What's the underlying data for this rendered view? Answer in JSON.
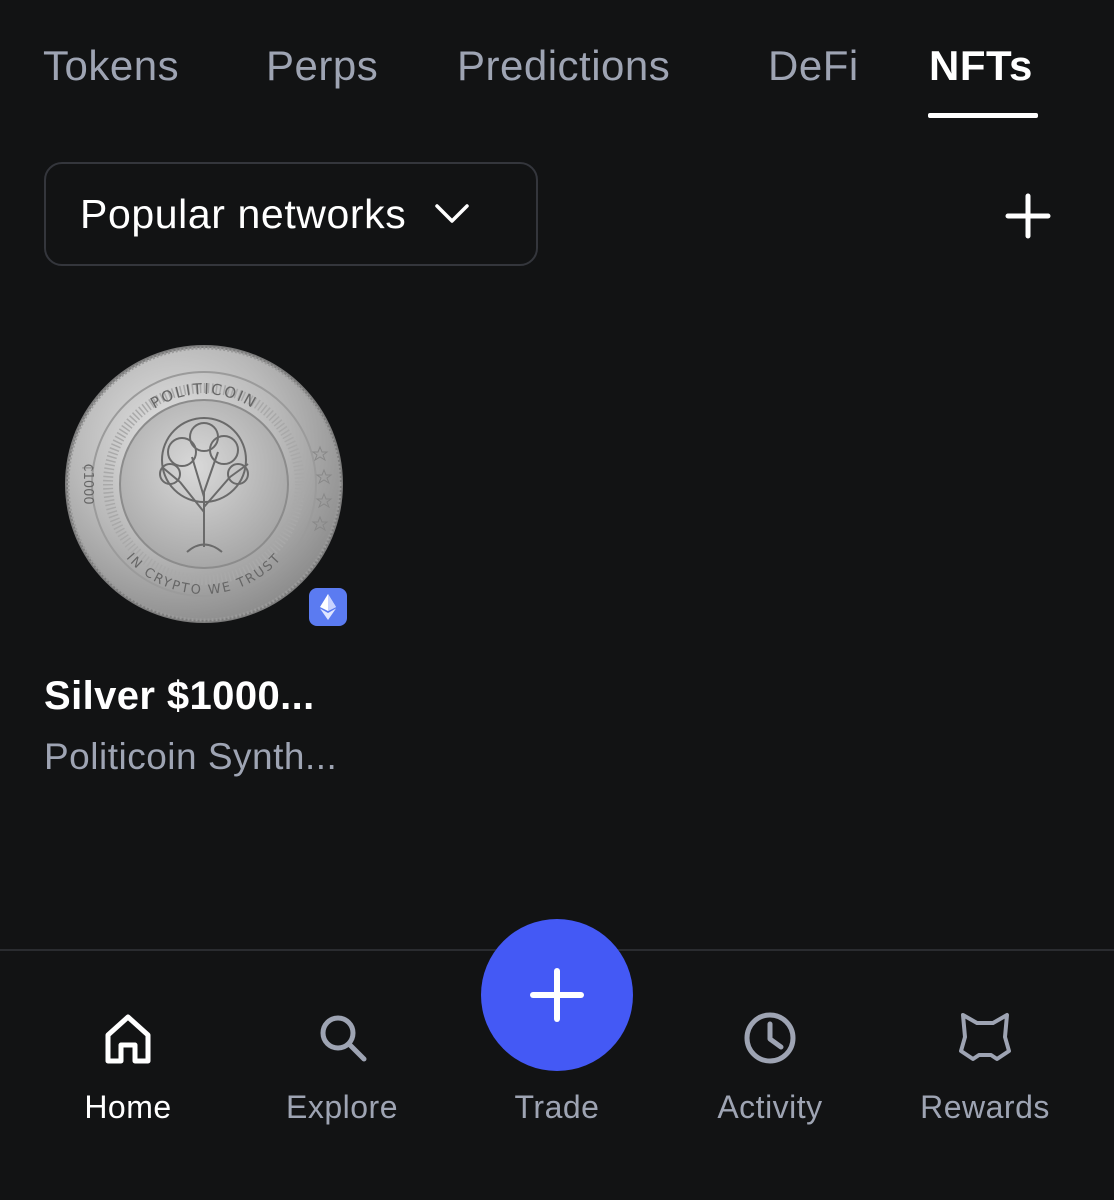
{
  "tabs": [
    {
      "label": "Tokens",
      "active": false
    },
    {
      "label": "Perps",
      "active": false
    },
    {
      "label": "Predictions",
      "active": false
    },
    {
      "label": "DeFi",
      "active": false
    },
    {
      "label": "NFTs",
      "active": true
    }
  ],
  "network_selector": {
    "label": "Popular networks",
    "icon": "chevron-down-icon"
  },
  "add_button": {
    "icon": "plus-icon"
  },
  "nfts": [
    {
      "name": "Silver $1000...",
      "collection": "Politicoin Synth...",
      "image": "silver-coin-image",
      "coin_text_top": "POLITICOIN",
      "coin_text_bottom": "IN CRYPTO WE TRUST",
      "coin_text_left": "₵1000",
      "network_badge": "ethereum-icon"
    }
  ],
  "bottom_nav": {
    "items": [
      {
        "label": "Home",
        "icon": "home-icon",
        "active": true
      },
      {
        "label": "Explore",
        "icon": "search-icon",
        "active": false
      },
      {
        "label": "Trade",
        "icon": "plus-icon",
        "active": false
      },
      {
        "label": "Activity",
        "icon": "clock-icon",
        "active": false
      },
      {
        "label": "Rewards",
        "icon": "fox-icon",
        "active": false
      }
    ]
  },
  "colors": {
    "background": "#121314",
    "text_primary": "#ffffff",
    "text_muted": "#9ea4b3",
    "accent": "#4459f5",
    "border": "#34363c",
    "eth_badge": "#5b7bf1"
  }
}
